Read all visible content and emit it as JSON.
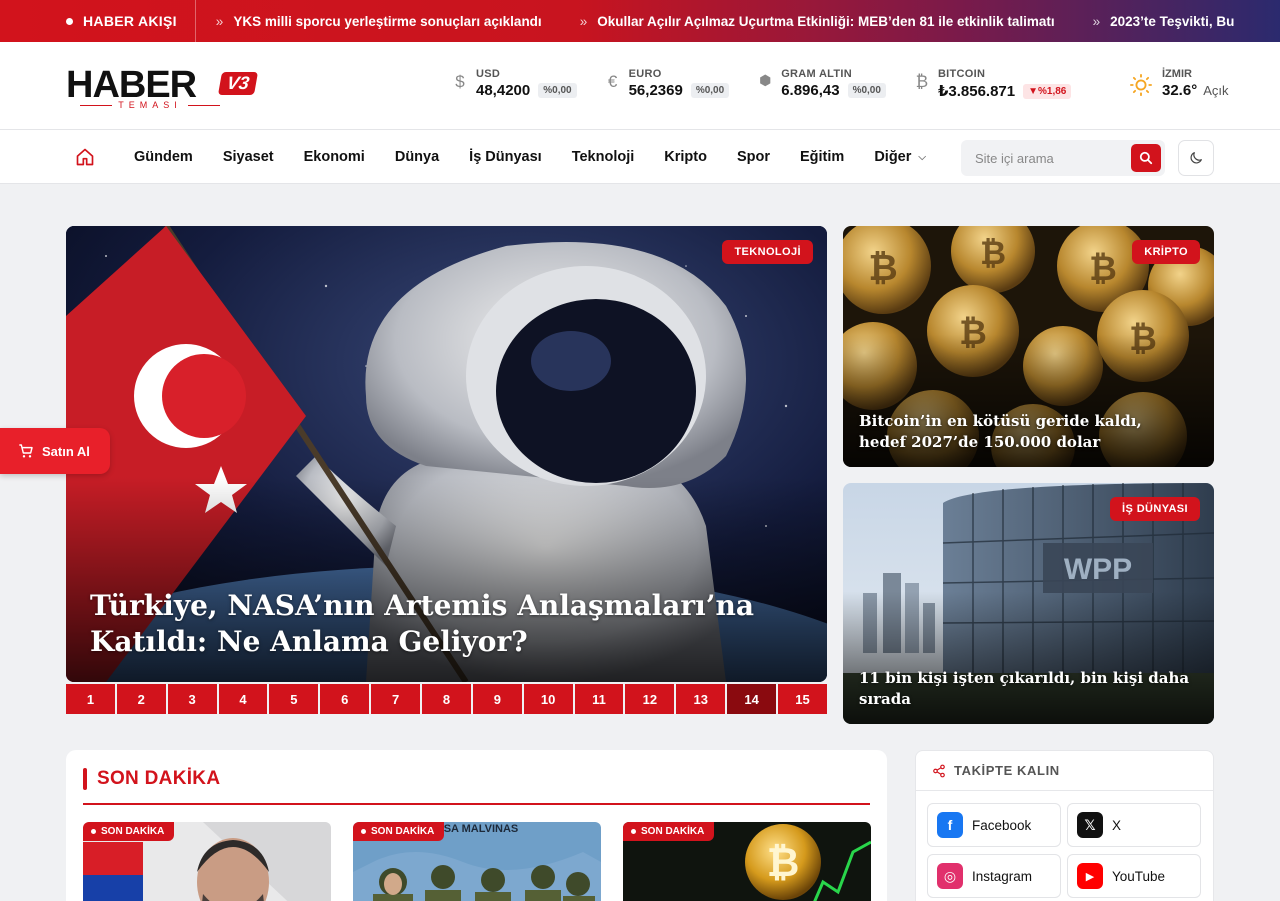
{
  "ticker": {
    "label": "HABER AKIŞI",
    "items": [
      "YKS milli sporcu yerleştirme sonuçları açıklandı",
      "Okullar Açılır Açılmaz Uçurtma Etkinliği: MEB’den 81 ile etkinlik talimatı",
      "2023’te Teşvikti, Bu"
    ]
  },
  "logo": {
    "word_main": "HABER",
    "badge": "V3",
    "sub": "TEMASI"
  },
  "markets": [
    {
      "icon": "dollar-icon",
      "glyph": "$",
      "label": "USD",
      "value": "48,4200",
      "change": "%0,00",
      "trend": "flat"
    },
    {
      "icon": "euro-icon",
      "glyph": "€",
      "label": "EURO",
      "value": "56,2369",
      "change": "%0,00",
      "trend": "flat"
    },
    {
      "icon": "gold-icon",
      "glyph": "⬢",
      "label": "GRAM ALTIN",
      "value": "6.896,43",
      "change": "%0,00",
      "trend": "flat"
    },
    {
      "icon": "bitcoin-icon",
      "glyph": "₿",
      "label": "BITCOIN",
      "value": "₺3.856.871",
      "change": "▼%1,86",
      "trend": "down"
    }
  ],
  "weather": {
    "city": "İZMIR",
    "temp": "32.6°",
    "condition": "Açık"
  },
  "nav": {
    "items": [
      "Gündem",
      "Siyaset",
      "Ekonomi",
      "Dünya",
      "İş Dünyası",
      "Teknoloji",
      "Kripto",
      "Spor",
      "Eğitim",
      "Diğer"
    ],
    "search_placeholder": "Site içi arama"
  },
  "hero": {
    "category": "TEKNOLOJİ",
    "title": "Türkiye, NASA’nın Artemis Anlaşmaları’na Katıldı: Ne Anlama Geliyor?",
    "pages": [
      "1",
      "2",
      "3",
      "4",
      "5",
      "6",
      "7",
      "8",
      "9",
      "10",
      "11",
      "12",
      "13",
      "14",
      "15"
    ],
    "active_page": "14"
  },
  "side": [
    {
      "category": "KRİPTO",
      "title": "Bitcoin’in en kötüsü geride kaldı, hedef 2027’de 150.000 dolar"
    },
    {
      "category": "İŞ DÜNYASI",
      "title": "11 bin kişi işten çıkarıldı, bin kişi daha sırada"
    }
  ],
  "buy_button": "Satın Al",
  "breaking": {
    "title": "SON DAKİKA",
    "cards": [
      {
        "badge": "SON DAKİKA"
      },
      {
        "badge": "SON DAKİKA"
      },
      {
        "badge": "SON DAKİKA"
      }
    ]
  },
  "follow": {
    "title": "TAKİPTE KALIN",
    "networks": [
      {
        "name": "Facebook",
        "icon": "facebook-icon",
        "color": "#1877f2"
      },
      {
        "name": "X",
        "icon": "x-icon",
        "color": "#111111"
      },
      {
        "name": "Instagram",
        "icon": "instagram-icon",
        "color": "#e1306c"
      },
      {
        "name": "YouTube",
        "icon": "youtube-icon",
        "color": "#ff0000"
      }
    ]
  },
  "colors": {
    "brand": "#d2131c",
    "brand_dark": "#8a0a0f"
  }
}
